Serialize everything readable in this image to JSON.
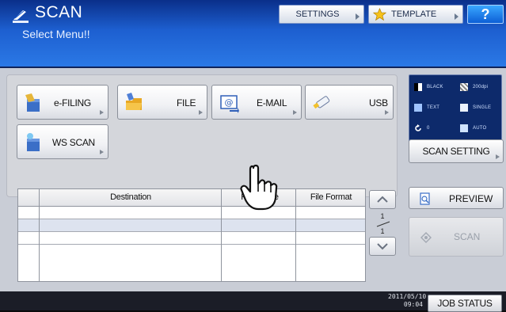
{
  "header": {
    "title": "SCAN",
    "subtitle": "Select Menu!!",
    "settings_label": "SETTINGS",
    "template_label": "TEMPLATE",
    "help_label": "?"
  },
  "menu": {
    "buttons": [
      {
        "label": "e-FILING",
        "icon": "efiling-icon"
      },
      {
        "label": "FILE",
        "icon": "folder-icon"
      },
      {
        "label": "E-MAIL",
        "icon": "email-icon"
      },
      {
        "label": "USB",
        "icon": "usb-icon"
      },
      {
        "label": "WS SCAN",
        "icon": "ws-scan-icon"
      }
    ]
  },
  "scan_settings": {
    "items": [
      {
        "label": "BLACK"
      },
      {
        "label": "200dpi"
      },
      {
        "label": "TEXT"
      },
      {
        "label": "SINGLE"
      },
      {
        "label": "0"
      },
      {
        "label": "AUTO"
      }
    ],
    "button_label": "SCAN SETTING"
  },
  "table": {
    "columns": [
      "Destination",
      "File Name",
      "File Format"
    ],
    "rows": [
      [
        "",
        "",
        ""
      ],
      [
        "",
        "",
        ""
      ],
      [
        "",
        "",
        ""
      ]
    ]
  },
  "pagination": {
    "current": "1",
    "total": "1"
  },
  "actions": {
    "preview_label": "PREVIEW",
    "scan_label": "SCAN"
  },
  "footer": {
    "date": "2011/05/10",
    "time": "09:04",
    "job_status_label": "JOB STATUS"
  },
  "colors": {
    "header_top": "#0a2f8a",
    "header_bottom": "#2b79e6",
    "panel": "#c9cdd6",
    "accent_blue": "#0c5fd6"
  }
}
